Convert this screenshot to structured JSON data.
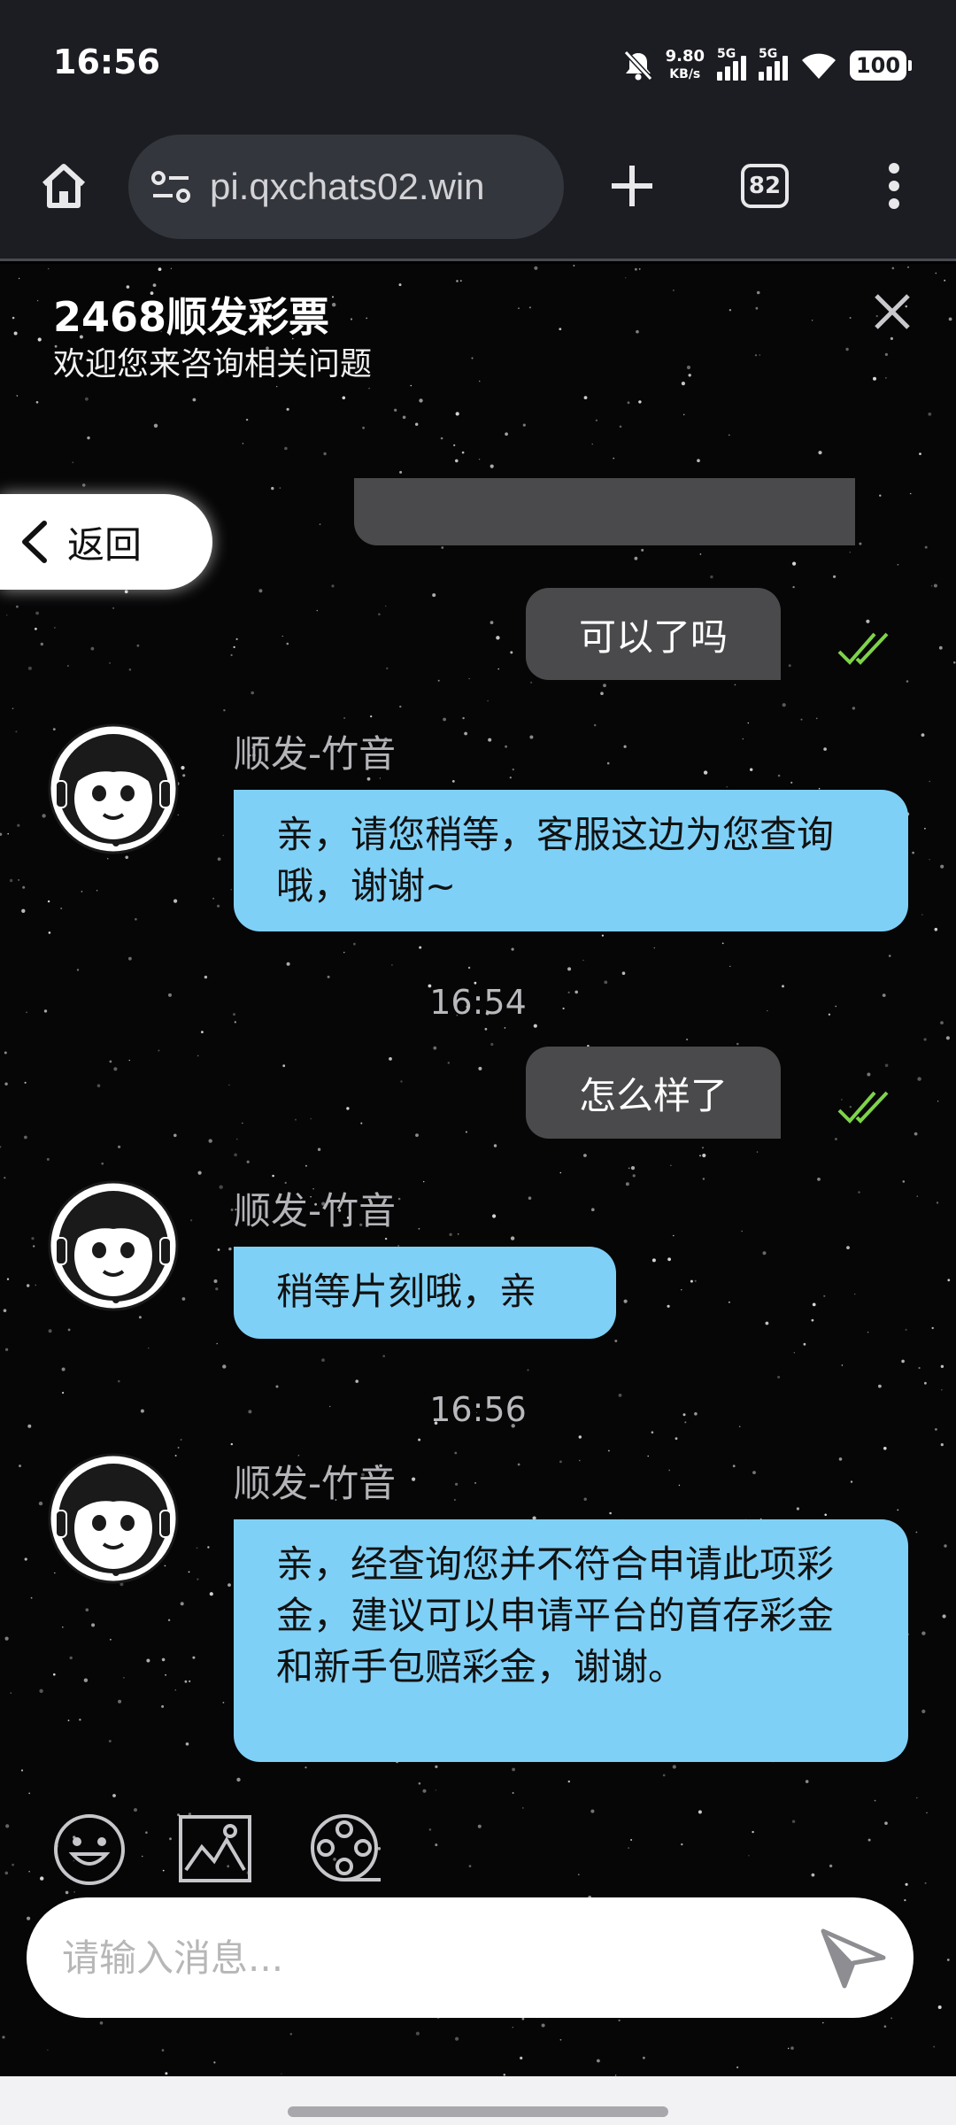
{
  "status_bar": {
    "time": "16:56",
    "net_speed_value": "9.80",
    "net_speed_unit": "KB/s",
    "sim1_label": "5G",
    "sim2_label": "5G",
    "battery": "100"
  },
  "browser": {
    "url": "pi.qxchats02.win",
    "tab_count": "82"
  },
  "chat": {
    "title": "2468顺发彩票",
    "subtitle": "欢迎您来咨询相关问题",
    "back_label": "返回",
    "input_placeholder": "请输入消息...",
    "messages": [
      {
        "type": "outgoing",
        "text": "可以了吗",
        "read": true
      },
      {
        "type": "incoming",
        "sender": "顺发-竹音",
        "text": "亲，请您稍等，客服这边为您查询哦，谢谢~"
      },
      {
        "type": "timestamp",
        "text": "16:54"
      },
      {
        "type": "outgoing",
        "text": "怎么样了",
        "read": true
      },
      {
        "type": "incoming",
        "sender": "顺发-竹音",
        "text": "稍等片刻哦，亲"
      },
      {
        "type": "timestamp",
        "text": "16:56"
      },
      {
        "type": "incoming",
        "sender": "顺发-竹音",
        "text": "亲，经查询您并不符合申请此项彩金，建议可以申请平台的首存彩金和新手包赔彩金，谢谢。"
      }
    ]
  },
  "colors": {
    "incoming_bubble": "#7fd0f6",
    "outgoing_bubble": "#4a4a4c",
    "read_check": "#7ed34a",
    "toolbar": "#1c1d22"
  },
  "icons": [
    "home-icon",
    "site-settings-icon",
    "plus-icon",
    "tab-switcher-icon",
    "more-vert-icon",
    "close-icon",
    "chevron-left-icon",
    "double-check-icon",
    "agent-avatar",
    "emoji-icon",
    "image-icon",
    "video-reel-icon",
    "send-icon"
  ]
}
